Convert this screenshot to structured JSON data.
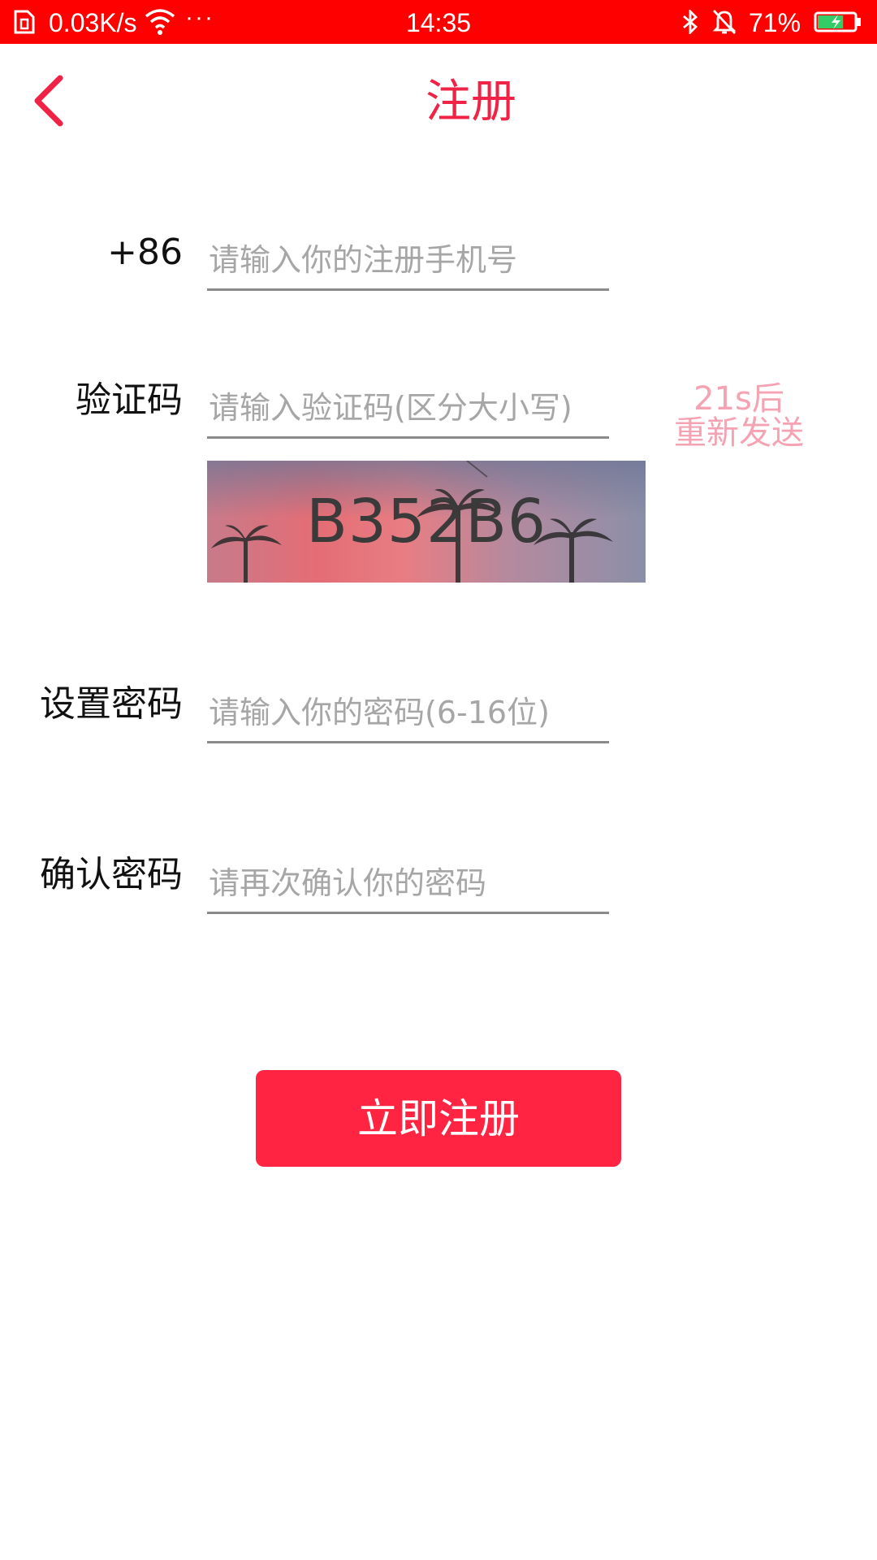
{
  "status_bar": {
    "net_speed": "0.03K/s",
    "more": "···",
    "time": "14:35",
    "battery_percent": "71%",
    "icons": [
      "sim-icon",
      "wifi-icon",
      "bluetooth-icon",
      "mute-bell-icon",
      "battery-charging-icon"
    ],
    "background_color": "#ff0000",
    "battery_level": 0.71
  },
  "header": {
    "title": "注册",
    "back_icon": "chevron-left-icon",
    "accent_color": "#f02346"
  },
  "form": {
    "phone": {
      "label": "+86",
      "placeholder": "请输入你的注册手机号",
      "value": ""
    },
    "code": {
      "label": "验证码",
      "placeholder": "请输入验证码(区分大小写)",
      "value": "",
      "resend_line1": "21s后",
      "resend_line2": "重新发送",
      "resend_color": "#f5a3b2"
    },
    "captcha": {
      "text": "B352B6"
    },
    "password": {
      "label": "设置密码",
      "placeholder": "请输入你的密码(6-16位)",
      "value": ""
    },
    "confirm": {
      "label": "确认密码",
      "placeholder": "请再次确认你的密码",
      "value": ""
    }
  },
  "submit": {
    "label": "立即注册",
    "color": "#ff2442"
  }
}
